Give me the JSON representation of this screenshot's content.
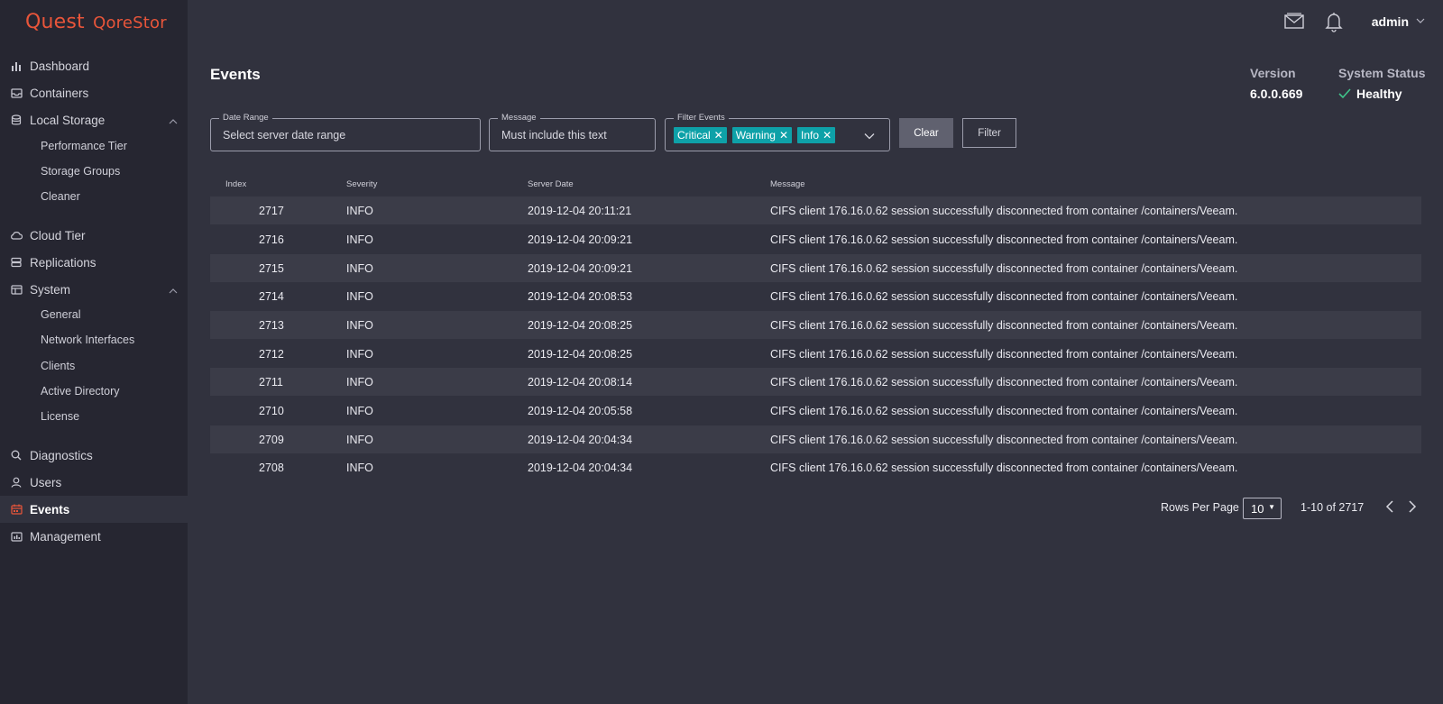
{
  "app": {
    "logo_a": "Quest",
    "logo_b": "QoreStor"
  },
  "header": {
    "user": "admin"
  },
  "sidebar": {
    "dashboard": "Dashboard",
    "containers": "Containers",
    "local_storage": "Local Storage",
    "local_storage_items": [
      "Performance Tier",
      "Storage Groups",
      "Cleaner"
    ],
    "cloud_tier": "Cloud Tier",
    "replications": "Replications",
    "system": "System",
    "system_items": [
      "General",
      "Network Interfaces",
      "Clients",
      "Active Directory",
      "License"
    ],
    "diagnostics": "Diagnostics",
    "users": "Users",
    "events": "Events",
    "management": "Management"
  },
  "page": {
    "title": "Events",
    "version_label": "Version",
    "version_value": "6.0.0.669",
    "status_label": "System Status",
    "status_value": "Healthy"
  },
  "filters": {
    "date_range_label": "Date Range",
    "date_range_placeholder": "Select server date range",
    "message_label": "Message",
    "message_placeholder": "Must include this text",
    "events_label": "Filter Events",
    "chips": [
      "Critical",
      "Warning",
      "Info"
    ],
    "clear_label": "Clear",
    "filter_label": "Filter"
  },
  "table": {
    "headers": [
      "Index",
      "Severity",
      "Server Date",
      "Message"
    ],
    "rows": [
      {
        "index": "2717",
        "severity": "INFO",
        "date": "2019-12-04 20:11:21",
        "message": "CIFS client 176.16.0.62 session successfully disconnected from container /containers/Veeam."
      },
      {
        "index": "2716",
        "severity": "INFO",
        "date": "2019-12-04 20:09:21",
        "message": "CIFS client 176.16.0.62 session successfully disconnected from container /containers/Veeam."
      },
      {
        "index": "2715",
        "severity": "INFO",
        "date": "2019-12-04 20:09:21",
        "message": "CIFS client 176.16.0.62 session successfully disconnected from container /containers/Veeam."
      },
      {
        "index": "2714",
        "severity": "INFO",
        "date": "2019-12-04 20:08:53",
        "message": "CIFS client 176.16.0.62 session successfully disconnected from container /containers/Veeam."
      },
      {
        "index": "2713",
        "severity": "INFO",
        "date": "2019-12-04 20:08:25",
        "message": "CIFS client 176.16.0.62 session successfully disconnected from container /containers/Veeam."
      },
      {
        "index": "2712",
        "severity": "INFO",
        "date": "2019-12-04 20:08:25",
        "message": "CIFS client 176.16.0.62 session successfully disconnected from container /containers/Veeam."
      },
      {
        "index": "2711",
        "severity": "INFO",
        "date": "2019-12-04 20:08:14",
        "message": "CIFS client 176.16.0.62 session successfully disconnected from container /containers/Veeam."
      },
      {
        "index": "2710",
        "severity": "INFO",
        "date": "2019-12-04 20:05:58",
        "message": "CIFS client 176.16.0.62 session successfully disconnected from container /containers/Veeam."
      },
      {
        "index": "2709",
        "severity": "INFO",
        "date": "2019-12-04 20:04:34",
        "message": "CIFS client 176.16.0.62 session successfully disconnected from container /containers/Veeam."
      },
      {
        "index": "2708",
        "severity": "INFO",
        "date": "2019-12-04 20:04:34",
        "message": "CIFS client 176.16.0.62 session successfully disconnected from container /containers/Veeam."
      }
    ]
  },
  "pagination": {
    "rows_per_page_label": "Rows Per Page",
    "rows_per_page_value": "10",
    "range": "1-10 of 2717"
  }
}
